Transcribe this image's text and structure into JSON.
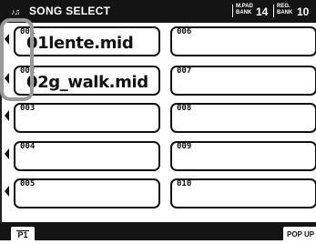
{
  "header": {
    "title_icon": "♪♫",
    "title": "SONG SELECT",
    "mpad_label_top": "M.PAD",
    "mpad_label_bottom": "BANK",
    "mpad_value": "14",
    "reg_label_top": "REG.",
    "reg_label_bottom": "BANK",
    "reg_value": "10"
  },
  "left_column": [
    {
      "num": "001",
      "name": "01lente.mid"
    },
    {
      "num": "002",
      "name": "02g_walk.mid"
    },
    {
      "num": "003",
      "name": ""
    },
    {
      "num": "004",
      "name": ""
    },
    {
      "num": "005",
      "name": ""
    }
  ],
  "right_column": [
    {
      "num": "006",
      "name": ""
    },
    {
      "num": "007",
      "name": ""
    },
    {
      "num": "008",
      "name": ""
    },
    {
      "num": "009",
      "name": ""
    },
    {
      "num": "010",
      "name": ""
    }
  ],
  "footer": {
    "page_tab": "P1",
    "popup_label": "POP UP"
  }
}
